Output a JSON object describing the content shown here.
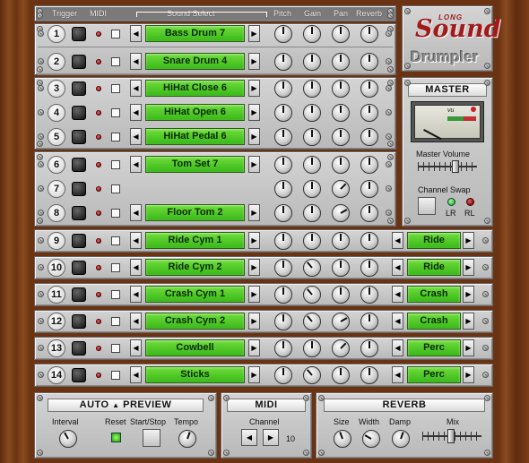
{
  "header": {
    "trigger": "Trigger",
    "midi": "MIDI",
    "sound_select": "Sound Select",
    "pitch": "Pitch",
    "gain": "Gain",
    "pan": "Pan",
    "reverb": "Reverb"
  },
  "logo": {
    "top": "LONG",
    "word": "Sound",
    "product": "Drumpler"
  },
  "pads": [
    {
      "num": "1",
      "sound": "Bass Drum 7"
    },
    {
      "num": "2",
      "sound": "Snare Drum 4"
    },
    {
      "num": "3",
      "sound": "HiHat Close 6"
    },
    {
      "num": "4",
      "sound": "HiHat Open 6"
    },
    {
      "num": "5",
      "sound": "HiHat Pedal 6"
    },
    {
      "num": "6",
      "sound": "Tom Set 7"
    },
    {
      "num": "7",
      "sound": ""
    },
    {
      "num": "8",
      "sound": "Floor Tom 2"
    },
    {
      "num": "9",
      "sound": "Ride Cym 1",
      "output": "Ride"
    },
    {
      "num": "10",
      "sound": "Ride Cym 2",
      "output": "Ride"
    },
    {
      "num": "11",
      "sound": "Crash Cym 1",
      "output": "Crash"
    },
    {
      "num": "12",
      "sound": "Crash Cym 2",
      "output": "Crash"
    },
    {
      "num": "13",
      "sound": "Cowbell",
      "output": "Perc"
    },
    {
      "num": "14",
      "sound": "Sticks",
      "output": "Perc"
    }
  ],
  "master": {
    "title": "MASTER",
    "vu_label": "vu",
    "master_volume": "Master Volume",
    "channel_swap": "Channel Swap",
    "lr": "LR",
    "rl": "RL"
  },
  "auto_preview": {
    "title_a": "AUTO",
    "title_b": "PREVIEW",
    "interval": "Interval",
    "reset": "Reset",
    "start_stop": "Start/Stop",
    "tempo": "Tempo"
  },
  "midi": {
    "title": "MIDI",
    "channel": "Channel",
    "channel_value": "10"
  },
  "reverb": {
    "title": "REVERB",
    "size": "Size",
    "width": "Width",
    "damp": "Damp",
    "mix": "Mix"
  },
  "icons": {
    "left": "left-arrow-icon",
    "right": "right-arrow-icon",
    "up": "up-arrow-icon"
  },
  "colors": {
    "lcd": "#4ccf27",
    "wood": "#6b3312",
    "plate": "#c6c6c6",
    "led_on": "#2fd12f",
    "led_off": "#9a1010"
  }
}
